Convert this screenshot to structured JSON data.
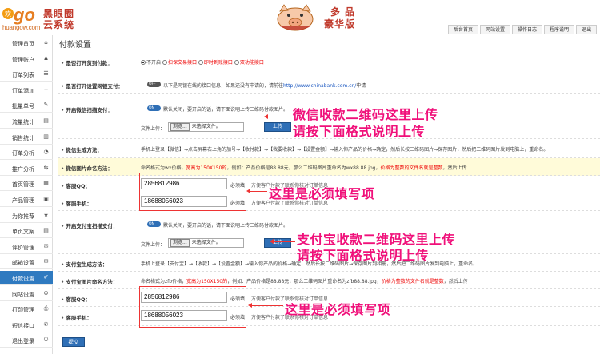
{
  "header": {
    "logo_text": "go",
    "logo_prefix": "欢",
    "logo_domain": "huangow.com",
    "brand_line1": "黑眼圈",
    "brand_line2": "云系统",
    "tagline_line1": "多品",
    "tagline_line2": "豪华版",
    "nav": [
      "后台首页",
      "网站设置",
      "操作日志",
      "程序说明",
      "退出"
    ]
  },
  "sidebar": {
    "items": [
      {
        "label": "管理首页",
        "icon": "home-icon",
        "glyph": "⌂"
      },
      {
        "label": "管理账户",
        "icon": "user-icon",
        "glyph": "♟"
      },
      {
        "label": "订单列表",
        "icon": "list-icon",
        "glyph": "☰"
      },
      {
        "label": "订单添加",
        "icon": "plus-icon",
        "glyph": "+"
      },
      {
        "label": "批量单号",
        "icon": "edit-icon",
        "glyph": "✎"
      },
      {
        "label": "流量统计",
        "icon": "chart-icon",
        "glyph": "▤"
      },
      {
        "label": "销售统计",
        "icon": "chart-icon",
        "glyph": "▥"
      },
      {
        "label": "订单分析",
        "icon": "pie-icon",
        "glyph": "◔"
      },
      {
        "label": "推广分析",
        "icon": "share-icon",
        "glyph": "⇆"
      },
      {
        "label": "首页管理",
        "icon": "page-icon",
        "glyph": "▦"
      },
      {
        "label": "产品管理",
        "icon": "box-icon",
        "glyph": "▣"
      },
      {
        "label": "为你推荐",
        "icon": "star-icon",
        "glyph": "★"
      },
      {
        "label": "单页文案",
        "icon": "doc-icon",
        "glyph": "▤"
      },
      {
        "label": "评价管理",
        "icon": "comment-icon",
        "glyph": "✉"
      },
      {
        "label": "邮箱设置",
        "icon": "mail-icon",
        "glyph": "✉"
      },
      {
        "label": "付款设置",
        "icon": "wrench-icon",
        "glyph": "✐"
      },
      {
        "label": "网站设置",
        "icon": "gear-icon",
        "glyph": "⚙"
      },
      {
        "label": "打印管理",
        "icon": "print-icon",
        "glyph": "⎙"
      },
      {
        "label": "短信接口",
        "icon": "message-icon",
        "glyph": "✆"
      },
      {
        "label": "退出登录",
        "icon": "power-icon",
        "glyph": "⏻"
      }
    ],
    "active_index": 15
  },
  "main": {
    "title": "付款设置",
    "cod": {
      "label": "是否打开货到付款：",
      "options": [
        "不开启",
        "扣保交易接口",
        "即时到账接口",
        "双功能接口"
      ],
      "selected": 0
    },
    "online": {
      "label": "是否打开设置网银支付：",
      "toggle": "OFF",
      "text_before": "以下是网银在线的接口信息，如果还没有申请的，请前往",
      "link": "http://www.chinabank.com.cn/",
      "text_after": "申请"
    },
    "wechat": {
      "label": "开启微信扫描支付：",
      "toggle": "ON",
      "desc": "默认关闭，要开启的话，请下面说明上传二维码付款图片。",
      "file_label": "文件上传：",
      "browse": "浏览...",
      "no_file": "未选择文件。",
      "upload": "上传",
      "method_label": "微信生成方法：",
      "method_text": "手机上登录【微信】→点击屏幕右上角的加号→【收付款】→【我要收款】→【设置金额】→输入你产品的价格→确定，然后长按二维码图片→保存图片，然后把二维码图片发到电脑上，重命名。",
      "naming_label": "微信图片命名方法：",
      "naming_a": "命名格式为wx价格，",
      "naming_b": "宽高为150X150的",
      "naming_c": "，例如：产品价格是88.88元，那么二维码图片重命名为wx88.88.jpg，",
      "naming_d": "价格为整数的文件名就是整数",
      "naming_e": "，然后上传",
      "qq_label": "客服QQ：",
      "qq_value": "2856812986",
      "phone_label": "客服手机：",
      "phone_value": "18688056023"
    },
    "alipay": {
      "label": "开启支付宝扫描支付：",
      "toggle": "ON",
      "desc": "默认关闭，要开启的话，请下面说明上传二维码付款图片。",
      "file_label": "文件上传：",
      "browse": "浏览...",
      "no_file": "未选择文件。",
      "upload": "上传",
      "method_label": "支付宝生成方法：",
      "method_text": "手机上登录【支付宝】→【收款】→【设置金额】→输入你产品的价格→确定，然后长按二维码图片→保存图片到相册，然后把二维码图片发到电脑上，重命名。",
      "naming_label": "支付宝图片命名方法：",
      "naming_a": "命名格式为zfb价格，",
      "naming_b": "宽高为150X150的",
      "naming_c": "，例如：产品价格是88.88元，那么二维码图片重命名为zfb88.88.jpg，",
      "naming_d": "价格为整数的文件名就是整数",
      "naming_e": "，然后上传",
      "qq_label": "客服QQ：",
      "qq_value": "2856812986",
      "phone_label": "客服手机：",
      "phone_value": "18688056023"
    },
    "required": "必须填",
    "hint": "方便客户付款了联系你核对订单信息",
    "submit": "提交"
  },
  "annotations": {
    "wechat_upload_1": "微信收款二维码这里上传",
    "wechat_upload_2": "请按下面格式说明上传",
    "wechat_required": "这里是必须填写项",
    "alipay_upload_1": "支付宝收款二维码这里上传",
    "alipay_upload_2": "请按下面格式说明上传",
    "alipay_required": "这里是必须填写项"
  },
  "colors": {
    "accent": "#2f7ac0",
    "brand_red": "#c0392b",
    "annotation": "#f0107a",
    "warning_red": "#e00"
  }
}
